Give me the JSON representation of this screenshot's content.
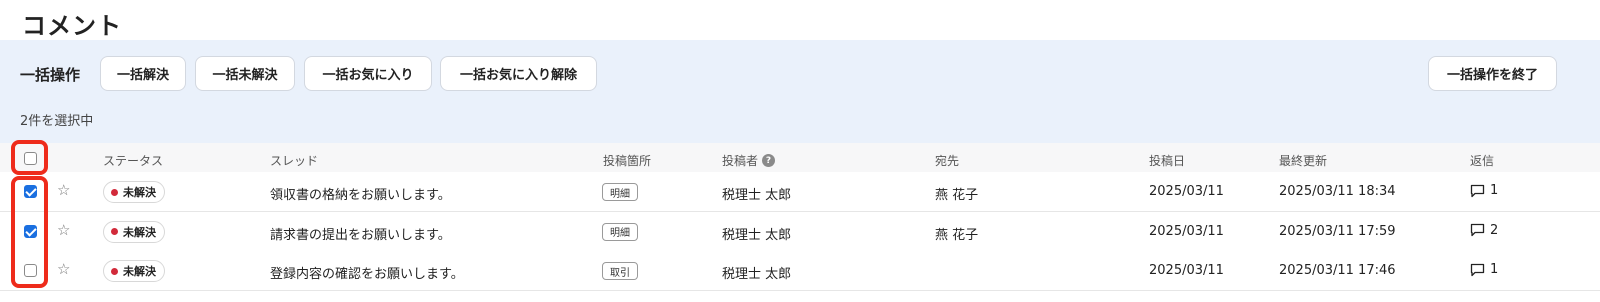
{
  "page": {
    "title": "コメント"
  },
  "bulk": {
    "label": "一括操作",
    "buttons": [
      "一括解決",
      "一括未解決",
      "一括お気に入り",
      "一括お気に入り解除"
    ],
    "end_button": "一括操作を終了",
    "selected_text": "2件を選択中"
  },
  "table": {
    "headers": {
      "status": "ステータス",
      "thread": "スレッド",
      "location": "投稿箇所",
      "author": "投稿者",
      "recipient": "宛先",
      "posted": "投稿日",
      "updated": "最終更新",
      "replies": "返信"
    },
    "select_all_checked": false,
    "rows": [
      {
        "checked": true,
        "starred": false,
        "status": "未解決",
        "thread": "領収書の格納をお願いします。",
        "location": "明細",
        "author": "税理士 太郎",
        "recipient": "燕 花子",
        "posted": "2025/03/11",
        "updated": "2025/03/11 18:34",
        "replies": "1"
      },
      {
        "checked": true,
        "starred": false,
        "status": "未解決",
        "thread": "請求書の提出をお願いします。",
        "location": "明細",
        "author": "税理士 太郎",
        "recipient": "燕 花子",
        "posted": "2025/03/11",
        "updated": "2025/03/11 17:59",
        "replies": "2"
      },
      {
        "checked": false,
        "starred": false,
        "status": "未解決",
        "thread": "登録内容の確認をお願いします。",
        "location": "取引",
        "author": "税理士 太郎",
        "recipient": "",
        "posted": "2025/03/11",
        "updated": "2025/03/11 17:46",
        "replies": "1"
      }
    ]
  },
  "icons": {
    "star": "star-outline-icon",
    "reply": "comment-bubble-icon",
    "help": "question-circle-icon",
    "status_dot": "status-dot-icon"
  },
  "colors": {
    "accent": "#1a6fe0",
    "highlight": "#ee2b1b",
    "unresolved_dot": "#d22a3a",
    "panel_bg": "#eaf1fb"
  }
}
